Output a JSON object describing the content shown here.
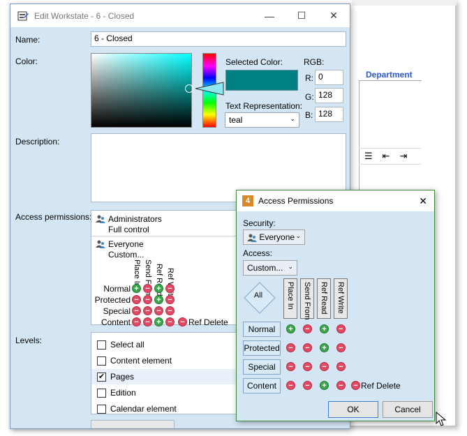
{
  "background": {
    "department_label": "Department"
  },
  "main_window": {
    "title": "Edit Workstate - 6 - Closed",
    "name_label": "Name:",
    "name_value": "6 - Closed",
    "color_label": "Color:",
    "selected_color_label": "Selected Color:",
    "selected_color_hex": "#008080",
    "rgb_label": "RGB:",
    "r_label": "R:",
    "r_value": "0",
    "g_label": "G:",
    "g_value": "128",
    "b_label": "B:",
    "b_value": "128",
    "text_rep_label": "Text Representation:",
    "text_rep_value": "teal",
    "description_label": "Description:",
    "access_label": "Access permissions:",
    "access_entries": [
      {
        "name": "Administrators",
        "detail": "Full control"
      },
      {
        "name": "Everyone",
        "detail": "Custom..."
      }
    ],
    "perm_columns": [
      "Place In",
      "Send From",
      "Ref Read",
      "Ref Write"
    ],
    "perm_rows": [
      {
        "label": "Normal",
        "values": [
          "+",
          "-",
          "+",
          "-"
        ]
      },
      {
        "label": "Protected",
        "values": [
          "-",
          "-",
          "+",
          "-"
        ]
      },
      {
        "label": "Special",
        "values": [
          "-",
          "-",
          "-",
          "-"
        ]
      },
      {
        "label": "Content",
        "values": [
          "-",
          "-",
          "+",
          "-"
        ],
        "extra": "Ref Delete"
      }
    ],
    "levels_label": "Levels:",
    "levels": [
      {
        "label": "Select all",
        "checked": false
      },
      {
        "label": "Content element",
        "checked": false
      },
      {
        "label": "Pages",
        "checked": true
      },
      {
        "label": "Edition",
        "checked": false
      },
      {
        "label": "Calendar element",
        "checked": false
      }
    ]
  },
  "access_dialog": {
    "title": "Access Permissions",
    "security_label": "Security:",
    "security_value": "Everyone",
    "access_label": "Access:",
    "access_value": "Custom...",
    "all_label": "All",
    "columns": [
      "Place In",
      "Send From",
      "Ref Read",
      "Ref Write"
    ],
    "rows": [
      {
        "label": "Normal",
        "values": [
          "+",
          "-",
          "+",
          "-"
        ]
      },
      {
        "label": "Protected",
        "values": [
          "-",
          "-",
          "+",
          "-"
        ]
      },
      {
        "label": "Special",
        "values": [
          "-",
          "-",
          "-",
          "-"
        ]
      },
      {
        "label": "Content",
        "values": [
          "-",
          "-",
          "+",
          "-"
        ],
        "extra": "Ref Delete"
      }
    ],
    "ok_label": "OK",
    "cancel_label": "Cancel"
  }
}
